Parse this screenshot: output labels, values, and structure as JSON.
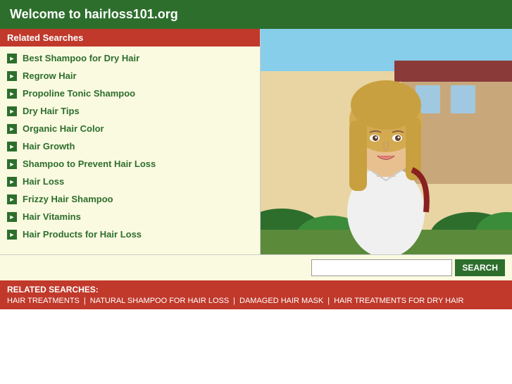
{
  "header": {
    "title": "Welcome to hairloss101.org"
  },
  "left_panel": {
    "section_header": "Related Searches",
    "links": [
      {
        "id": "link-1",
        "label": "Best Shampoo for Dry Hair"
      },
      {
        "id": "link-2",
        "label": "Regrow Hair"
      },
      {
        "id": "link-3",
        "label": "Propoline Tonic Shampoo"
      },
      {
        "id": "link-4",
        "label": "Dry Hair Tips"
      },
      {
        "id": "link-5",
        "label": "Organic Hair Color"
      },
      {
        "id": "link-6",
        "label": "Hair Growth"
      },
      {
        "id": "link-7",
        "label": "Shampoo to Prevent Hair Loss"
      },
      {
        "id": "link-8",
        "label": "Hair Loss"
      },
      {
        "id": "link-9",
        "label": "Frizzy Hair Shampoo"
      },
      {
        "id": "link-10",
        "label": "Hair Vitamins"
      },
      {
        "id": "link-11",
        "label": "Hair Products for Hair Loss"
      }
    ]
  },
  "search": {
    "placeholder": "",
    "button_label": "SEARCH"
  },
  "footer": {
    "related_label": "RELATED SEARCHES:",
    "links": [
      {
        "id": "footer-1",
        "label": "HAIR TREATMENTS"
      },
      {
        "id": "footer-2",
        "label": "NATURAL SHAMPOO FOR HAIR LOSS"
      },
      {
        "id": "footer-3",
        "label": "DAMAGED HAIR MASK"
      },
      {
        "id": "footer-4",
        "label": "HAIR TREATMENTS FOR DRY HAIR"
      }
    ],
    "separator": "|"
  },
  "colors": {
    "dark_green": "#2d6e2d",
    "red": "#c0392b",
    "cream_bg": "#fafae0"
  }
}
